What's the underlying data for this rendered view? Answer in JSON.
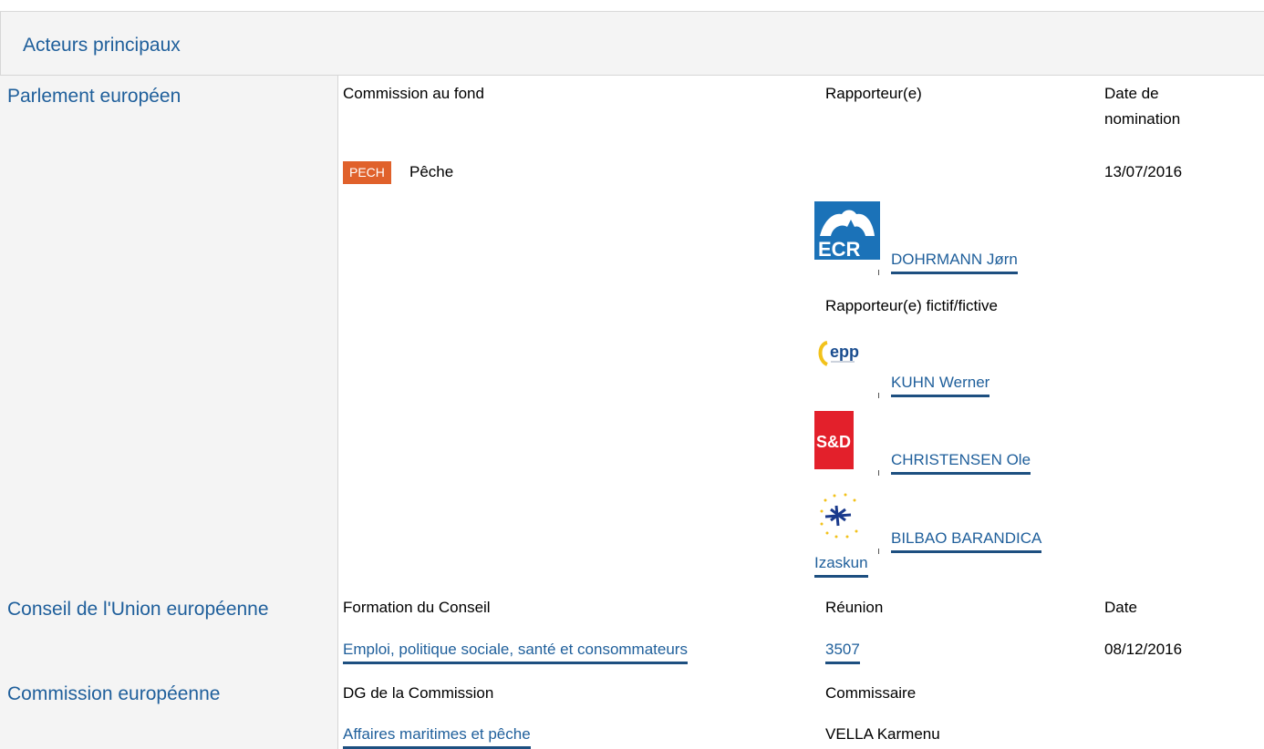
{
  "header": {
    "title": "Acteurs principaux"
  },
  "parliament": {
    "label": "Parlement européen",
    "col_committee": "Commission au fond",
    "col_rapporteur": "Rapporteur(e)",
    "col_date_line1": "Date de",
    "col_date_line2": "nomination",
    "committee_code": "PECH",
    "committee_name": "Pêche",
    "date": "13/07/2016",
    "rapporteur": {
      "group": "ECR",
      "name": "DOHRMANN Jørn"
    },
    "shadow_label": "Rapporteur(e) fictif/fictive",
    "shadows": [
      {
        "group": "epp",
        "name": "KUHN Werner"
      },
      {
        "group": "S&D",
        "name": "CHRISTENSEN Ole"
      },
      {
        "group": "EFA",
        "name_line1": "BILBAO BARANDICA",
        "name_line2": "Izaskun"
      }
    ]
  },
  "council": {
    "label": "Conseil de l'Union européenne",
    "col_formation": "Formation du Conseil",
    "col_meeting": "Réunion",
    "col_date": "Date",
    "formation": "Emploi, politique sociale, santé et consommateurs",
    "meeting": "3507",
    "date": "08/12/2016"
  },
  "commission": {
    "label": "Commission européenne",
    "col_dg": "DG de la Commission",
    "col_commissioner": "Commissaire",
    "dg": "Affaires maritimes et pêche",
    "commissioner": "VELLA Karmenu"
  },
  "colors": {
    "link": "#1f5f9b",
    "badge": "#e0612b",
    "ecr": "#1b72b8",
    "sd": "#e3202b"
  }
}
